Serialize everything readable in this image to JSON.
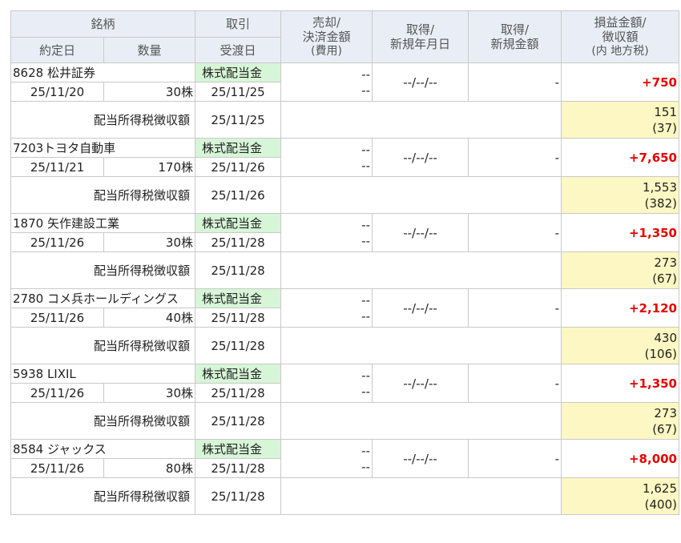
{
  "header": {
    "col_meigara": "銘柄",
    "col_torihiki": "取引",
    "col_baikyaku": [
      "売却/",
      "決済金額",
      "(費用)"
    ],
    "col_shutoku_date": [
      "取得/",
      "新規年月日"
    ],
    "col_shutoku_amount": [
      "取得/",
      "新規金額"
    ],
    "col_pl": [
      "損益金額/",
      "徴収額",
      "(内 地方税)"
    ],
    "col_yakujo": "約定日",
    "col_suryo": "数量",
    "col_ukewatashi": "受渡日"
  },
  "tax_label": "配当所得税徴収額",
  "kind_label": "株式配当金",
  "dash": "--",
  "date_dash": "--/--/--",
  "amount_dash": "-",
  "rows": [
    {
      "code_name": "8628 松井証券",
      "trade_date": "25/11/20",
      "qty": "30株",
      "settle_date": "25/11/25",
      "pl": "+750",
      "tax_date": "25/11/25",
      "tax_amount": "151",
      "tax_local": "(37)"
    },
    {
      "code_name": "7203トヨタ自動車",
      "trade_date": "25/11/21",
      "qty": "170株",
      "settle_date": "25/11/26",
      "pl": "+7,650",
      "tax_date": "25/11/26",
      "tax_amount": "1,553",
      "tax_local": "(382)"
    },
    {
      "code_name": "1870 矢作建設工業",
      "trade_date": "25/11/26",
      "qty": "30株",
      "settle_date": "25/11/28",
      "pl": "+1,350",
      "tax_date": "25/11/28",
      "tax_amount": "273",
      "tax_local": "(67)"
    },
    {
      "code_name": "2780 コメ兵ホールディングス",
      "trade_date": "25/11/26",
      "qty": "40株",
      "settle_date": "25/11/28",
      "pl": "+2,120",
      "tax_date": "25/11/28",
      "tax_amount": "430",
      "tax_local": "(106)"
    },
    {
      "code_name": "5938 LIXIL",
      "trade_date": "25/11/26",
      "qty": "30株",
      "settle_date": "25/11/28",
      "pl": "+1,350",
      "tax_date": "25/11/28",
      "tax_amount": "273",
      "tax_local": "(67)"
    },
    {
      "code_name": "8584 ジャックス",
      "trade_date": "25/11/26",
      "qty": "80株",
      "settle_date": "25/11/28",
      "pl": "+8,000",
      "tax_date": "25/11/28",
      "tax_amount": "1,625",
      "tax_local": "(400)"
    }
  ]
}
